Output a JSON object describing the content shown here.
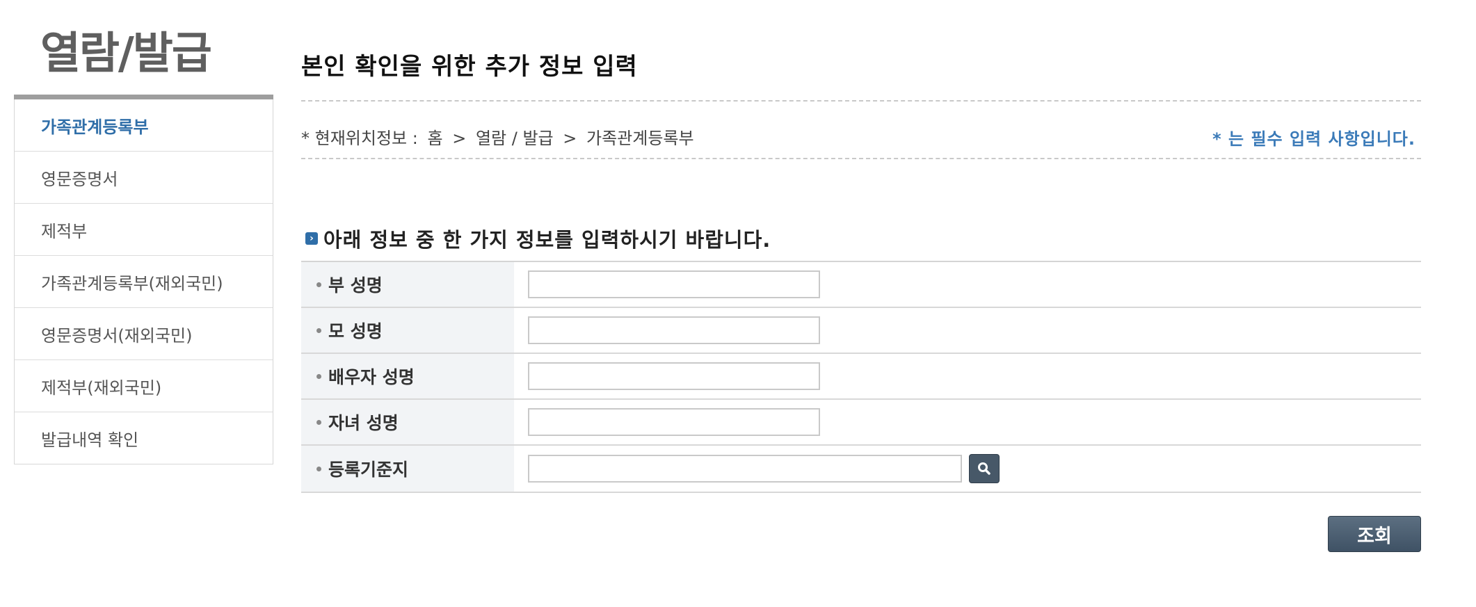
{
  "sidebar": {
    "title": "열람/발급",
    "items": [
      {
        "label": "가족관계등록부",
        "active": true
      },
      {
        "label": "영문증명서"
      },
      {
        "label": "제적부"
      },
      {
        "label": "가족관계등록부(재외국민)"
      },
      {
        "label": "영문증명서(재외국민)"
      },
      {
        "label": "제적부(재외국민)"
      },
      {
        "label": "발급내역 확인"
      }
    ]
  },
  "main": {
    "title": "본인 확인을 위한 추가 정보 입력",
    "breadcrumb": {
      "prefix": "* 현재위치정보 :",
      "home": "홈",
      "sep": ">",
      "level1": "열람 / 발급",
      "level2": "가족관계등록부"
    },
    "required_note": "* 는 필수 입력 사항입니다.",
    "section_heading": "아래 정보 중 한 가지 정보를 입력하시기 바랍니다.",
    "fields": [
      {
        "label": "부 성명",
        "value": ""
      },
      {
        "label": "모 성명",
        "value": ""
      },
      {
        "label": "배우자 성명",
        "value": ""
      },
      {
        "label": "자녀 성명",
        "value": ""
      },
      {
        "label": "등록기준지",
        "value": ""
      }
    ],
    "submit_label": "조회"
  },
  "icons": {
    "section_bullet": "arrow-right-icon",
    "search": "search-icon"
  },
  "colors": {
    "accent": "#2f6ea8",
    "required": "#3a7ab8",
    "button": "#475868"
  }
}
